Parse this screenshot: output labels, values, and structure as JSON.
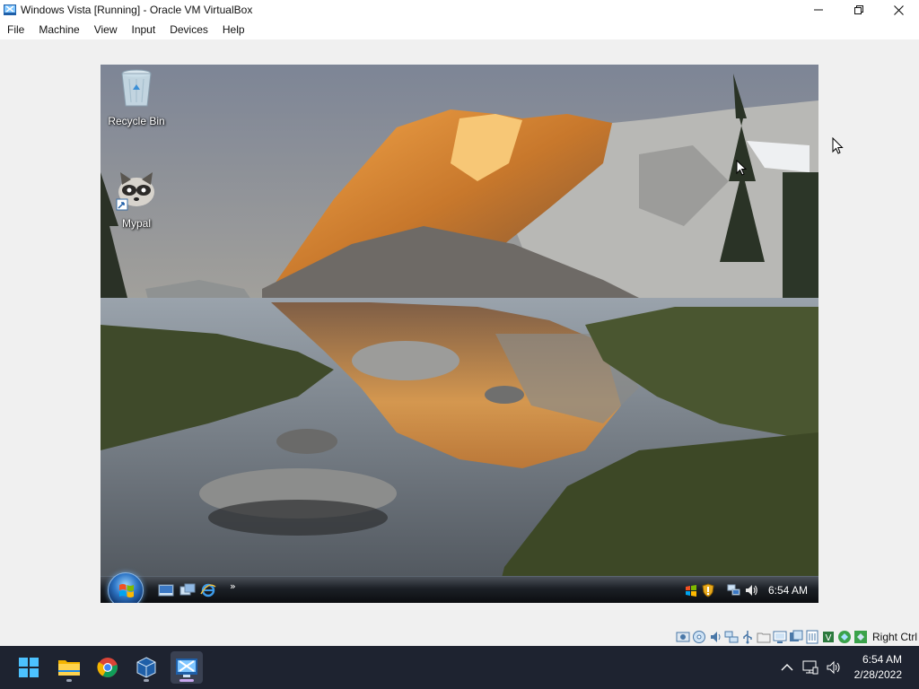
{
  "window": {
    "title": "Windows Vista [Running] - Oracle VM VirtualBox"
  },
  "menu": {
    "items": [
      "File",
      "Machine",
      "View",
      "Input",
      "Devices",
      "Help"
    ]
  },
  "guest": {
    "desktop_icons": [
      {
        "label": "Recycle Bin",
        "icon": "recycle-bin-icon"
      },
      {
        "label": "Mypal",
        "icon": "mypal-raccoon-icon"
      }
    ],
    "taskbar": {
      "quick_launch": [
        "show-desktop-icon",
        "switch-windows-icon",
        "internet-explorer-icon"
      ],
      "more_glyph": "»",
      "tray_icons": [
        "windows-flag-icon",
        "security-shield-icon",
        "network-icon",
        "volume-icon"
      ],
      "clock": "6:54 AM"
    }
  },
  "vbox_status": {
    "icons": [
      "hard-disk-icon",
      "optical-drive-icon",
      "audio-icon",
      "network-icon",
      "usb-icon",
      "shared-folders-icon",
      "display-icon",
      "video-capture-icon",
      "recording-icon",
      "cpu-icon",
      "mouse-integration-icon",
      "keyboard-icon"
    ],
    "host_key": "Right Ctrl"
  },
  "host_taskbar": {
    "apps": [
      "windows-start-icon",
      "file-explorer-icon",
      "chrome-icon",
      "virtualbox-icon",
      "vista-vm-icon"
    ],
    "tray": [
      "chevron-up-icon",
      "network-icon",
      "volume-icon"
    ],
    "time": "6:54 AM",
    "date": "2/28/2022"
  },
  "colors": {
    "host_taskbar_bg": "#1e2330",
    "vista_taskbar_bg": "#1c2026"
  }
}
